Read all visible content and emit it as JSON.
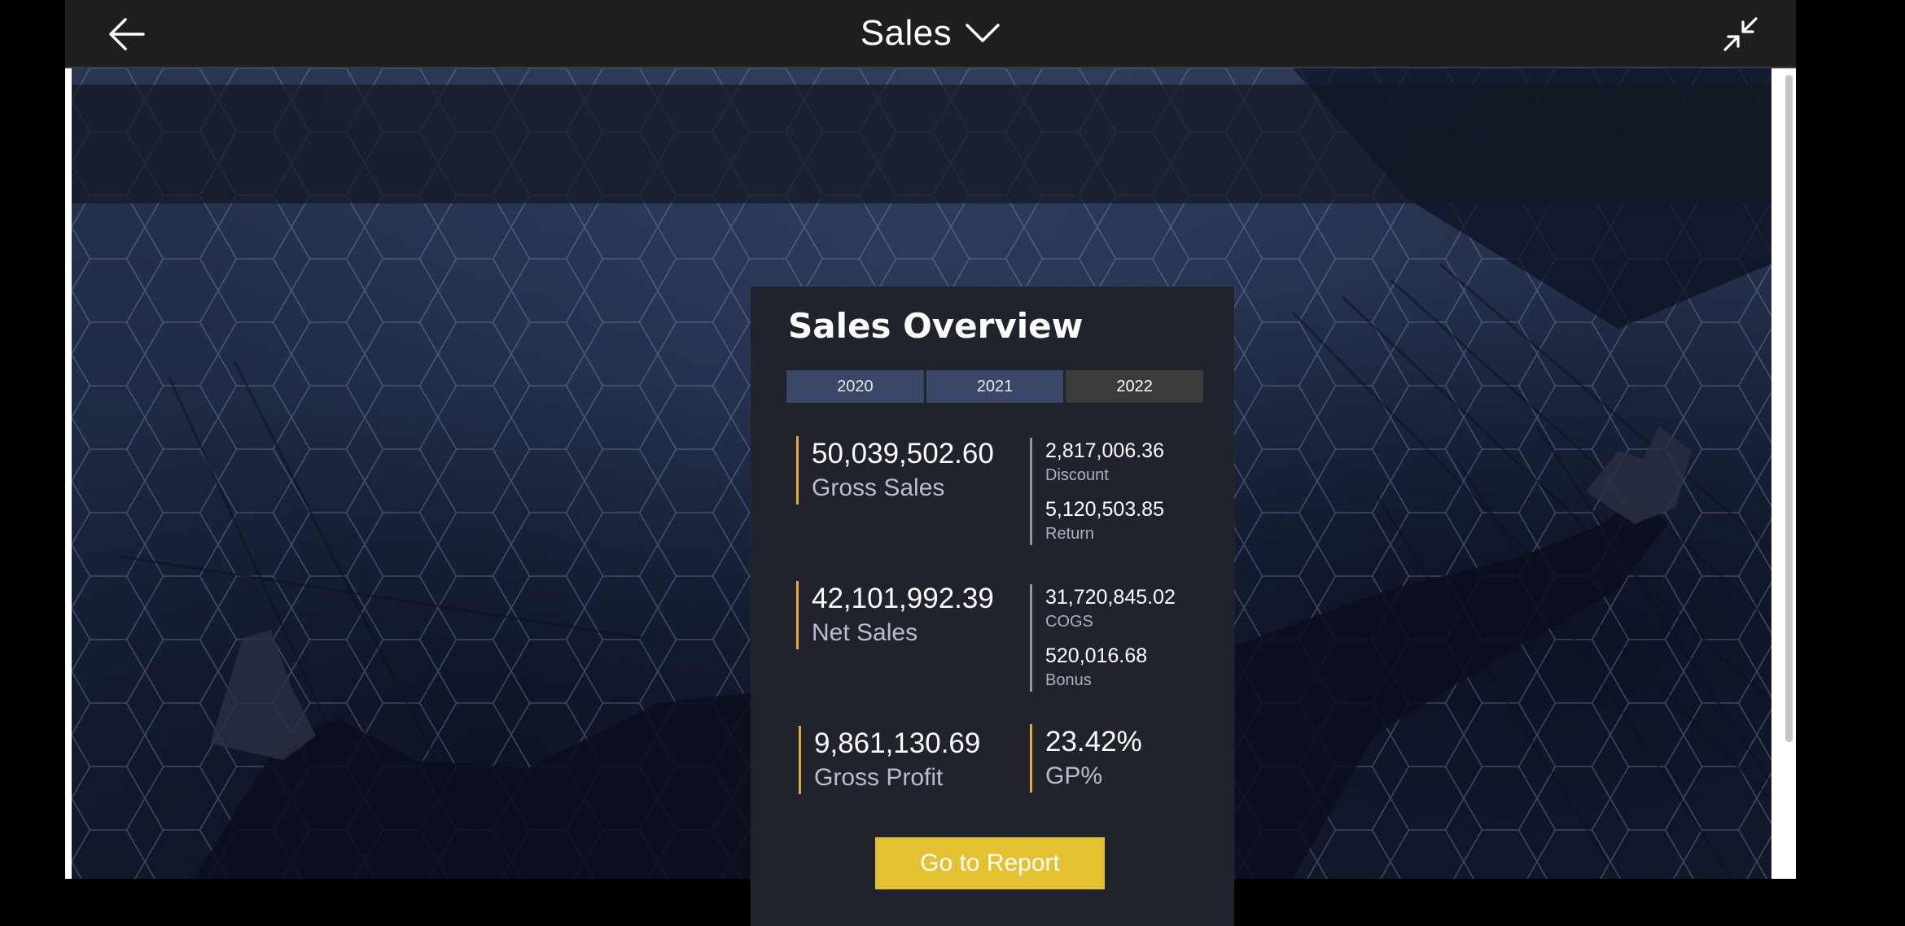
{
  "appbar": {
    "title": "Sales",
    "back_icon": "arrow-left-icon",
    "dropdown_icon": "chevron-down-icon",
    "collapse_icon": "collapse-arrows-icon"
  },
  "card": {
    "title": "Sales Overview",
    "year_tabs": [
      {
        "label": "2020",
        "active": false
      },
      {
        "label": "2021",
        "active": false
      },
      {
        "label": "2022",
        "active": true
      }
    ],
    "gross_sales": {
      "value": "50,039,502.60",
      "label": "Gross Sales"
    },
    "discount": {
      "value": "2,817,006.36",
      "label": "Discount"
    },
    "return": {
      "value": "5,120,503.85",
      "label": "Return"
    },
    "net_sales": {
      "value": "42,101,992.39",
      "label": "Net Sales"
    },
    "cogs": {
      "value": "31,720,845.02",
      "label": "COGS"
    },
    "bonus": {
      "value": "520,016.68",
      "label": "Bonus"
    },
    "gross_profit": {
      "value": "9,861,130.69",
      "label": "Gross Profit"
    },
    "gp_percent": {
      "value": "23.42%",
      "label": "GP%"
    },
    "go_button": "Go to Report"
  },
  "colors": {
    "accent": "#e5a83a",
    "button": "#e3c130",
    "tab": "#3a4766",
    "tab_active": "#3b3b3b",
    "card": "#20232c",
    "appbar": "#1f1f1f"
  }
}
